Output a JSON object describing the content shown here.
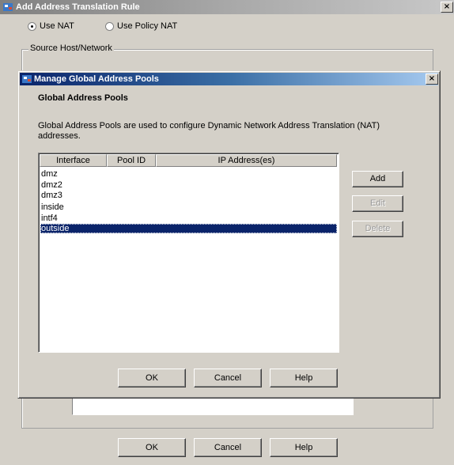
{
  "window": {
    "title": "Add Address Translation Rule",
    "close_glyph": "×"
  },
  "nat_mode": {
    "use_nat": "Use NAT",
    "use_policy_nat": "Use Policy NAT",
    "selected": "use_nat"
  },
  "source_group": {
    "label": "Source Host/Network"
  },
  "main_buttons": {
    "ok": "OK",
    "cancel": "Cancel",
    "help": "Help"
  },
  "dialog": {
    "title": "Manage Global Address Pools",
    "close_glyph": "×",
    "heading": "Global Address Pools",
    "description": "Global Address Pools are used to configure Dynamic Network Address Translation (NAT) addresses.",
    "columns": [
      "Interface",
      "Pool ID",
      "IP Address(es)"
    ],
    "rows": [
      "dmz",
      "dmz2",
      "dmz3",
      "inside",
      "intf4",
      "outside"
    ],
    "selected_row": "outside",
    "side_buttons": {
      "add": "Add",
      "edit": "Edit",
      "delete": "Delete"
    },
    "buttons": {
      "ok": "OK",
      "cancel": "Cancel",
      "help": "Help"
    }
  },
  "colors": {
    "title_active": "#0a246a",
    "title_inactive": "#808080",
    "face": "#d4d0c8",
    "selection": "#0a246a"
  }
}
